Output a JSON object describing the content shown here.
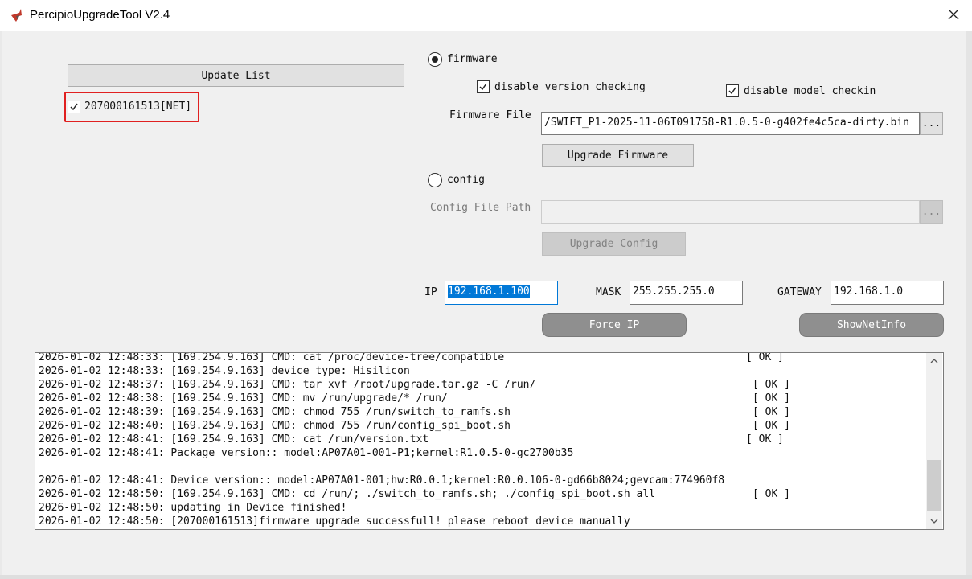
{
  "window": {
    "title": "PercipioUpgradeTool V2.4",
    "close_symbol": "✕"
  },
  "device_list": {
    "update_button": "Update List",
    "devices": [
      {
        "label": "207000161513[NET]",
        "checked": true
      }
    ]
  },
  "firmware": {
    "radio_label": "firmware",
    "selected": true,
    "disable_version_checking": "disable version checking",
    "disable_model_checkin": "disable model checkin",
    "file_label": "Firmware File",
    "file_value": "/SWIFT_P1-2025-11-06T091758-R1.0.5-0-g402fe4c5ca-dirty.bin",
    "browse_button": "...",
    "upgrade_button": "Upgrade Firmware"
  },
  "config": {
    "radio_label": "config",
    "selected": false,
    "file_label": "Config File Path",
    "file_value": "",
    "browse_button": "...",
    "upgrade_button": "Upgrade Config"
  },
  "network": {
    "ip_label": "IP",
    "ip_value": "192.168.1.100",
    "mask_label": "MASK",
    "mask_value": "255.255.255.0",
    "gateway_label": "GATEWAY",
    "gateway_value": "192.168.1.0",
    "force_ip_button": "Force IP",
    "show_net_info_button": "ShowNetInfo"
  },
  "log": {
    "lines": [
      {
        "text": "2026-01-02 12:48:33: [169.254.9.163] CMD: cat /proc/device-tree/compatible",
        "status": "[ OK ]"
      },
      {
        "text": "2026-01-02 12:48:33: [169.254.9.163] device type: Hisilicon",
        "status": ""
      },
      {
        "text": "2026-01-02 12:48:37: [169.254.9.163] CMD: tar xvf /root/upgrade.tar.gz -C /run/",
        "status": "[ OK ]"
      },
      {
        "text": "2026-01-02 12:48:38: [169.254.9.163] CMD: mv /run/upgrade/* /run/",
        "status": "[ OK ]"
      },
      {
        "text": "2026-01-02 12:48:39: [169.254.9.163] CMD: chmod 755 /run/switch_to_ramfs.sh",
        "status": "[ OK ]"
      },
      {
        "text": "2026-01-02 12:48:40: [169.254.9.163] CMD: chmod 755 /run/config_spi_boot.sh",
        "status": "[ OK ]"
      },
      {
        "text": "2026-01-02 12:48:41: [169.254.9.163] CMD: cat /run/version.txt",
        "status": "[ OK ]"
      },
      {
        "text": "2026-01-02 12:48:41: Package version:: model:AP07A01-001-P1;kernel:R1.0.5-0-gc2700b35",
        "status": ""
      },
      {
        "text": "",
        "status": ""
      },
      {
        "text": "2026-01-02 12:48:41: Device version:: model:AP07A01-001;hw:R0.0.1;kernel:R0.0.106-0-gd66b8024;gevcam:774960f8",
        "status": ""
      },
      {
        "text": "2026-01-02 12:48:50: [169.254.9.163] CMD: cd /run/; ./switch_to_ramfs.sh; ./config_spi_boot.sh all",
        "status": "[ OK ]"
      },
      {
        "text": "2026-01-02 12:48:50: updating in Device finished!",
        "status": ""
      },
      {
        "text": "2026-01-02 12:48:50: [207000161513]firmware upgrade successfull! please reboot device manually",
        "status": ""
      }
    ]
  }
}
